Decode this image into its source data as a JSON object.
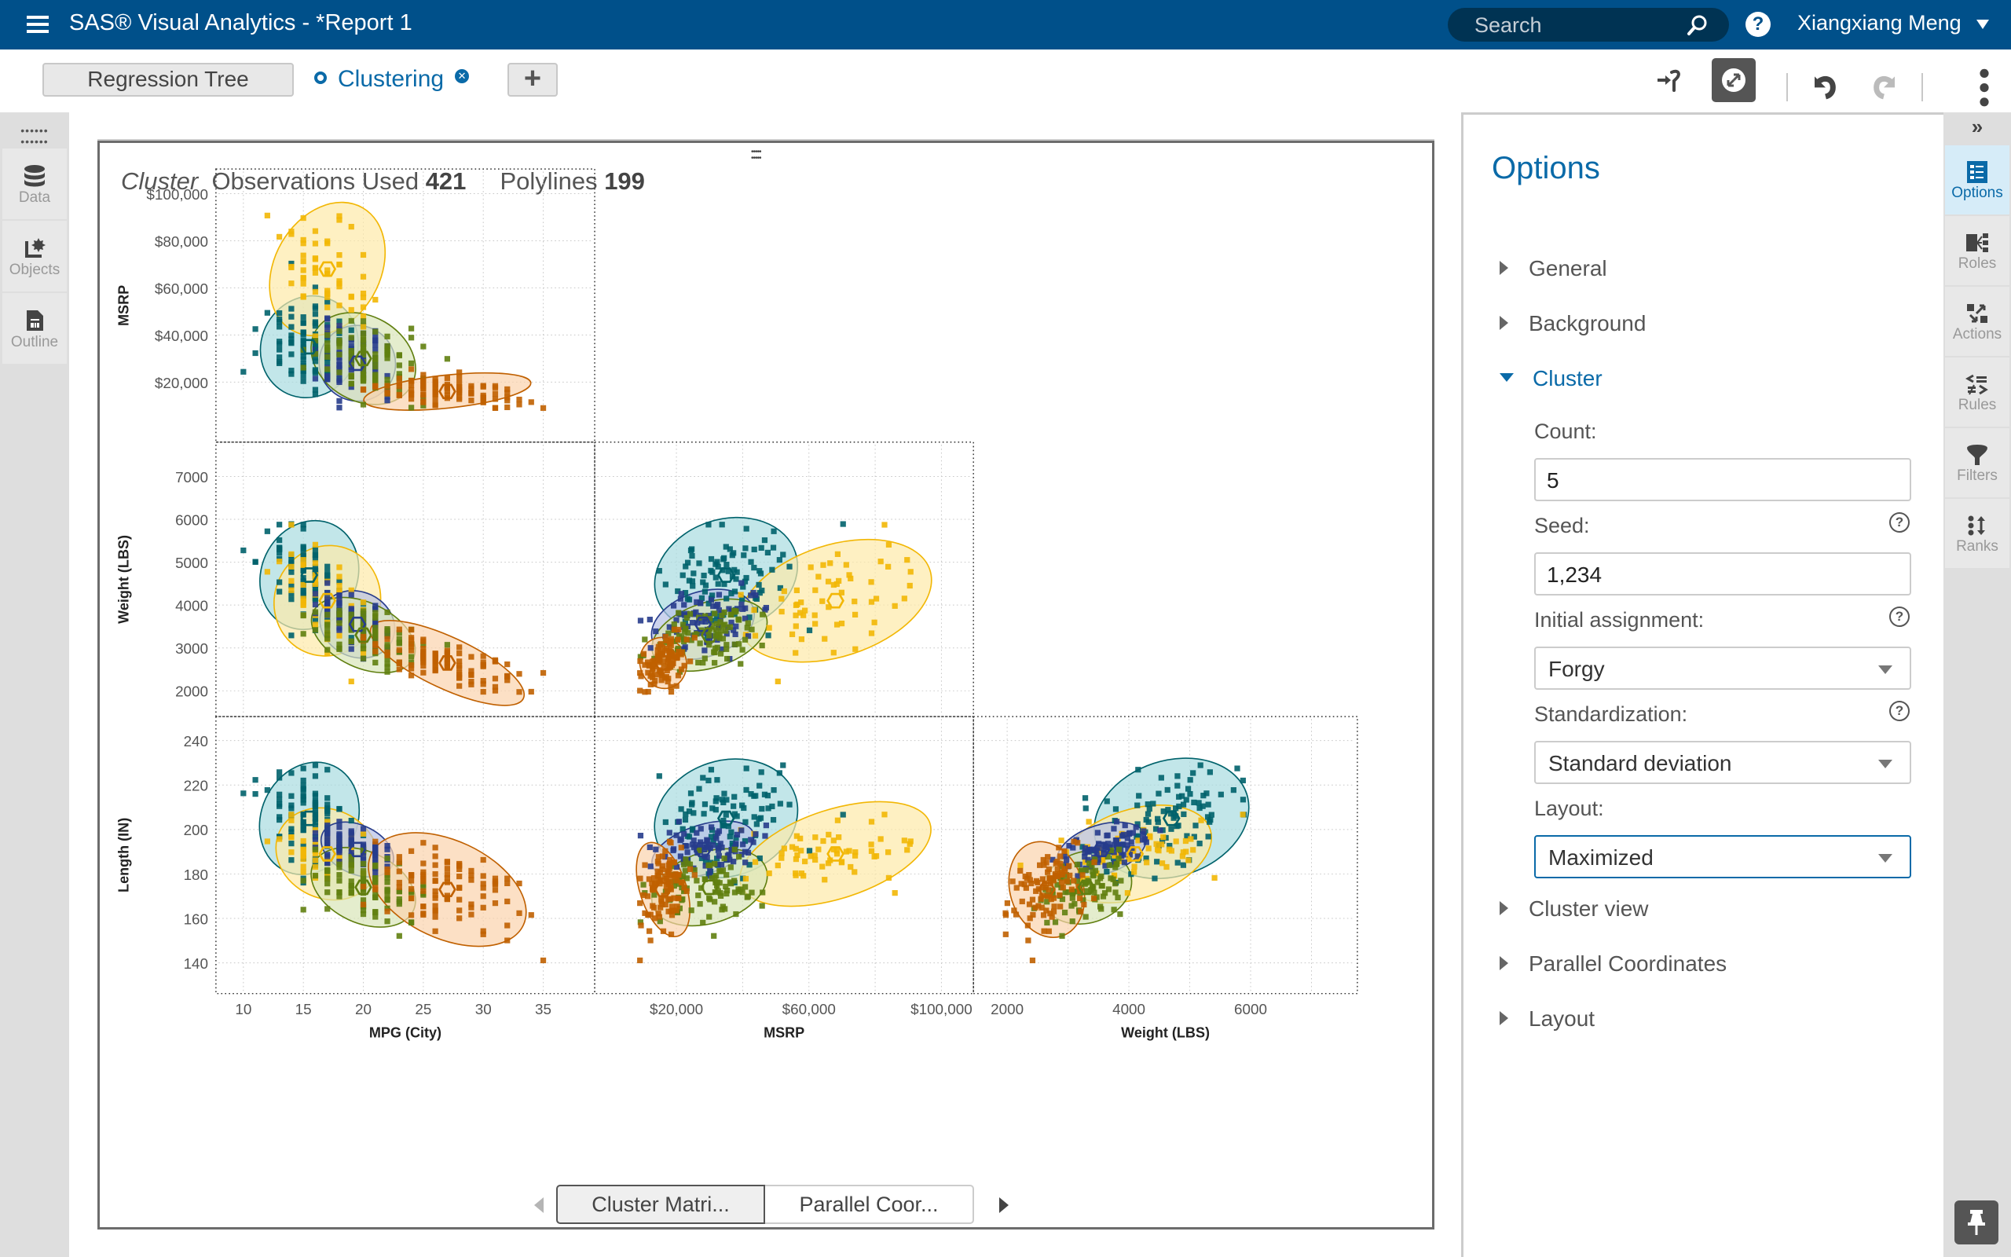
{
  "header": {
    "app_title": "SAS® Visual Analytics - *Report 1",
    "search_placeholder": "Search",
    "user_name": "Xiangxiang Meng",
    "menu_icon": "hamburger-icon",
    "search_icon": "magnifier-icon",
    "help_icon": "question-icon"
  },
  "report_tabs": {
    "tabs": [
      {
        "label": "Regression Tree",
        "active": false
      },
      {
        "label": "Clustering",
        "active": true
      }
    ],
    "add_label": "+"
  },
  "toolbar": {
    "icons": [
      "data-driven-content-icon",
      "interactive-mode-icon",
      "undo-icon",
      "redo-icon",
      "more-options-icon"
    ]
  },
  "left_rail": {
    "items": [
      {
        "label": "Data",
        "icon": "database-icon"
      },
      {
        "label": "Objects",
        "icon": "objects-icon"
      },
      {
        "label": "Outline",
        "icon": "outline-icon"
      }
    ]
  },
  "panel": {
    "title_italic": "Cluster",
    "obs_label": "Observations Used",
    "obs_value": "421",
    "poly_label": "Polylines",
    "poly_value": "199",
    "bottom_tabs": [
      {
        "label": "Cluster Matri...",
        "active": true
      },
      {
        "label": "Parallel Coor...",
        "active": false
      }
    ]
  },
  "chart_data": {
    "type": "scatter",
    "title": "Cluster Matrix",
    "variables": [
      "MPG (City)",
      "MSRP",
      "Weight (LBS)",
      "Length (IN)"
    ],
    "axes": {
      "MPG (City)": {
        "ticks": [
          10,
          15,
          20,
          25,
          30,
          35
        ],
        "tick_labels": [
          "10",
          "15",
          "20",
          "25",
          "30",
          "35"
        ],
        "range": [
          9,
          38
        ]
      },
      "MSRP": {
        "ticks": [
          20000,
          40000,
          60000,
          80000,
          100000
        ],
        "tick_labels": [
          "$20,000",
          "$40,000",
          "$60,000",
          "$80,000",
          "$100,000"
        ],
        "range": [
          0,
          105000
        ]
      },
      "Weight (LBS)": {
        "ticks": [
          2000,
          3000,
          4000,
          5000,
          6000,
          7000
        ],
        "tick_labels": [
          "2000",
          "3000",
          "4000",
          "5000",
          "6000",
          "7000"
        ],
        "range": [
          1700,
          7500
        ]
      },
      "Length (IN)": {
        "ticks": [
          140,
          160,
          180,
          200,
          220,
          240
        ],
        "tick_labels": [
          "140",
          "160",
          "180",
          "200",
          "220",
          "240"
        ],
        "range": [
          132,
          245
        ]
      }
    },
    "x_tick_labels_bottom": {
      "MPG (City)": [
        "10",
        "15",
        "20",
        "25",
        "30",
        "35"
      ],
      "MSRP": [
        "$20,000",
        "$60,000",
        "$100,000"
      ],
      "Weight (LBS)": [
        "2000",
        "4000",
        "6000"
      ]
    },
    "panels": [
      {
        "row": "MSRP",
        "col": "MPG (City)"
      },
      {
        "row": "Weight (LBS)",
        "col": "MPG (City)"
      },
      {
        "row": "Weight (LBS)",
        "col": "MSRP"
      },
      {
        "row": "Length (IN)",
        "col": "MPG (City)"
      },
      {
        "row": "Length (IN)",
        "col": "MSRP"
      },
      {
        "row": "Length (IN)",
        "col": "Weight (LBS)"
      }
    ],
    "clusters": [
      {
        "id": 1,
        "color": "#00626b",
        "fill": "#a8dbe0",
        "centroid": {
          "MPG (City)": 15.5,
          "MSRP": 35000,
          "Weight (LBS)": 4700,
          "Length (IN)": 205
        }
      },
      {
        "id": 2,
        "color": "#f2b705",
        "fill": "#fde9a8",
        "centroid": {
          "MPG (City)": 17,
          "MSRP": 68000,
          "Weight (LBS)": 4100,
          "Length (IN)": 189
        }
      },
      {
        "id": 3,
        "color": "#273c8c",
        "fill": "#b7c0e6",
        "centroid": {
          "MPG (City)": 19.5,
          "MSRP": 28000,
          "Weight (LBS)": 3550,
          "Length (IN)": 191
        }
      },
      {
        "id": 4,
        "color": "#607f10",
        "fill": "#d8e6b8",
        "centroid": {
          "MPG (City)": 20,
          "MSRP": 30000,
          "Weight (LBS)": 3300,
          "Length (IN)": 174
        }
      },
      {
        "id": 5,
        "color": "#c06000",
        "fill": "#fbd3ad",
        "centroid": {
          "MPG (City)": 27,
          "MSRP": 16000,
          "Weight (LBS)": 2650,
          "Length (IN)": 173
        }
      }
    ],
    "cluster_stddev": [
      {
        "MPG (City)": 2.0,
        "MSRP": 11000,
        "Weight (LBS)": 650,
        "Length (IN)": 13
      },
      {
        "MPG (City)": 2.2,
        "MSRP": 15000,
        "Weight (LBS)": 650,
        "Length (IN)": 10
      },
      {
        "MPG (City)": 1.6,
        "MSRP": 8000,
        "Weight (LBS)": 380,
        "Length (IN)": 5.5
      },
      {
        "MPG (City)": 2.3,
        "MSRP": 9000,
        "Weight (LBS)": 380,
        "Length (IN)": 8
      },
      {
        "MPG (City)": 3.5,
        "MSRP": 3500,
        "Weight (LBS)": 300,
        "Length (IN)": 11
      }
    ],
    "observations_used": 421,
    "grid": true,
    "legend": "none"
  },
  "options": {
    "title": "Options",
    "sections": [
      {
        "label": "General",
        "expanded": false
      },
      {
        "label": "Background",
        "expanded": false
      },
      {
        "label": "Cluster",
        "expanded": true
      },
      {
        "label": "Cluster view",
        "expanded": false
      },
      {
        "label": "Parallel Coordinates",
        "expanded": false
      },
      {
        "label": "Layout",
        "expanded": false
      }
    ],
    "cluster": {
      "count_label": "Count:",
      "count_value": "5",
      "seed_label": "Seed:",
      "seed_value": "1,234",
      "init_label": "Initial assignment:",
      "init_value": "Forgy",
      "std_label": "Standardization:",
      "std_value": "Standard deviation",
      "layout_label": "Layout:",
      "layout_value": "Maximized"
    }
  },
  "right_rail": {
    "collapse_label": "»",
    "items": [
      {
        "label": "Options",
        "icon": "options-icon",
        "active": true
      },
      {
        "label": "Roles",
        "icon": "roles-icon",
        "active": false
      },
      {
        "label": "Actions",
        "icon": "actions-icon",
        "active": false
      },
      {
        "label": "Rules",
        "icon": "rules-icon",
        "active": false
      },
      {
        "label": "Filters",
        "icon": "filter-icon",
        "active": false
      },
      {
        "label": "Ranks",
        "icon": "ranks-icon",
        "active": false
      }
    ],
    "pin_icon": "pin-icon"
  },
  "colors": {
    "brand": "#00508a",
    "accent": "#0a6aa8"
  }
}
